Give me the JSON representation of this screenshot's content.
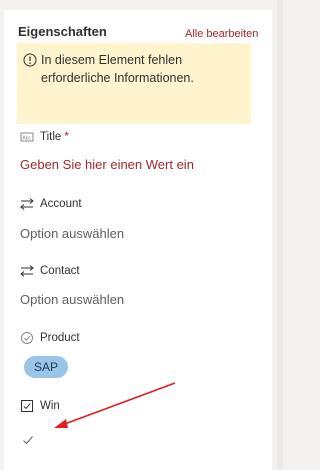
{
  "header": {
    "title": "Eigenschaften",
    "edit_all_link": "Alle bearbeiten"
  },
  "warning": {
    "icon": "info-circle-icon",
    "text": "In diesem Element fehlen erforderliche Informationen."
  },
  "fields": {
    "title": {
      "icon": "text-field-icon",
      "label": "Title",
      "required_marker": "*",
      "value": "Geben Sie hier einen Wert ein"
    },
    "account": {
      "icon": "lookup-arrows-icon",
      "label": "Account",
      "value": "Option auswählen"
    },
    "contact": {
      "icon": "lookup-arrows-icon",
      "label": "Contact",
      "value": "Option auswählen"
    },
    "product": {
      "icon": "choice-check-circle-icon",
      "label": "Product",
      "tag": "SAP"
    },
    "win": {
      "icon": "checkbox-icon",
      "label": "Win",
      "value_icon": "checkmark-icon",
      "checked": true
    }
  },
  "colors": {
    "accent_error": "#a4262c",
    "warning_bg": "#fff4ce",
    "tag_bg": "#9ac5e8",
    "annotation_arrow": "#e02020"
  }
}
